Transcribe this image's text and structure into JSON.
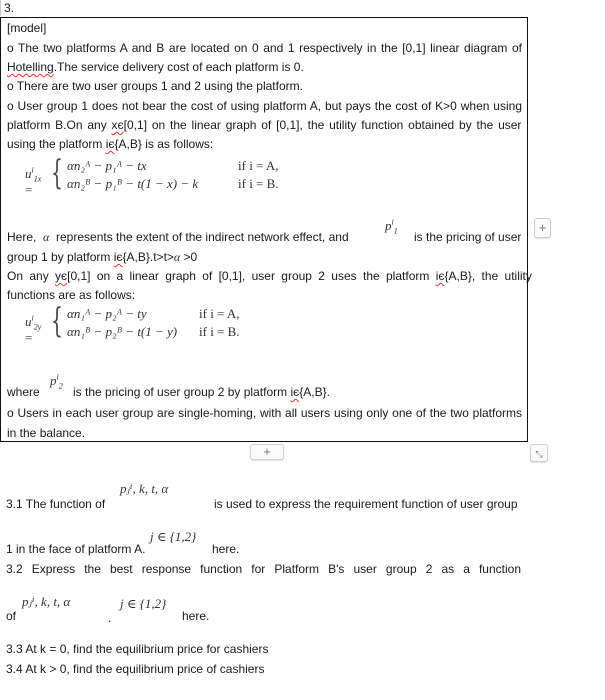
{
  "question_number": "3.",
  "model": {
    "heading": "[model]",
    "p1_a": "o The two platforms A and B are located on 0 and 1 respectively in the [0,1] linear diagram of",
    "p1_b_word": "Hotelling",
    "p1_b_rest": ".The service delivery cost of each platform is 0.",
    "p2": "o There are two user groups 1 and 2 using the platform.",
    "p3_a": "o User group 1 does not bear the cost of using platform A, but pays the cost of K>0 when using",
    "p3_b_pre": "platform B.On any ",
    "p3_b_sq": "xє",
    "p3_b_post": "[0,1] on the linear graph of [0,1], the utility function obtained by the user",
    "p3_c_pre": "using the platform ",
    "p3_c_sq": "iє",
    "p3_c_post": "{A,B} is as follows:",
    "eq1": {
      "lhs": "u",
      "lhs_sup": "i",
      "lhs_sub": "1x",
      "row1": "αn₂ᴬ − p₁ᴬ − tx",
      "row1_cond": "if  i = A,",
      "row2": "αn₂ᴮ − p₁ᴮ − t(1 − x) − k",
      "row2_cond": "if  i = B."
    },
    "here_pre": "Here,",
    "alpha_symbol": "α",
    "here_mid": "represents the extent of the indirect network effect, and",
    "p1i_symbol": "p",
    "p1i_sup": "i",
    "p1i_sub": "1",
    "here_post": "is the pricing of user",
    "group1_pre": "group 1 by platform ",
    "group1_sq": "iє",
    "group1_post": "{A,B}.t>t>",
    "group1_alpha": "α",
    "group1_end": " >0",
    "y_pre": "On any ",
    "y_sq": "yє",
    "y_mid": "[0,1] on a linear graph of [0,1], user group 2 uses the platform ",
    "y_sq2": "iє",
    "y_post": "{A,B}, the utility",
    "y_line2": "functions are as follows:",
    "eq2": {
      "lhs": "u",
      "lhs_sup": "i",
      "lhs_sub": "2y",
      "row1": "αn₁ᴬ − p₂ᴬ − ty",
      "row1_cond": "if  i = A,",
      "row2": "αn₁ᴮ − p₂ᴮ − t(1 − y)",
      "row2_cond": "if  i = B."
    },
    "where_pre": "where",
    "p2i_symbol": "p",
    "p2i_sup": "i",
    "p2i_sub": "2",
    "where_post_pre": "is the pricing of user group 2 by platform ",
    "where_sq": "iє",
    "where_post": "{A,B}.",
    "p4_a": "o Users in each user group are single-homing, with all users using only one of the two platforms",
    "p4_b": "in the balance."
  },
  "controls": {
    "add_side_label": "+",
    "add_below_label": "+",
    "resize_label": "⤡"
  },
  "questions": {
    "q31_pre": "3.1 The function of",
    "q31_math": "pⱼⁱ,  k,  t,  α",
    "q31_post": "is used to express the requirement function of user group",
    "q31_line2": "1 in the face of platform A.",
    "q31_j": "j ∈ {1,2}",
    "q31_here": "here.",
    "q32_a": "3.2 Express the best response function for Platform B's user group 2 as a function",
    "q32_of": "of",
    "q32_math": "pⱼⁱ,  k,  t,  α",
    "q32_dot": ".",
    "q32_j": "j ∈ {1,2}",
    "q32_here": "here.",
    "q33": "3.3 At k = 0, find the equilibrium price for cashiers",
    "q34": "3.4 At k > 0, find the equilibrium price of cashiers"
  }
}
